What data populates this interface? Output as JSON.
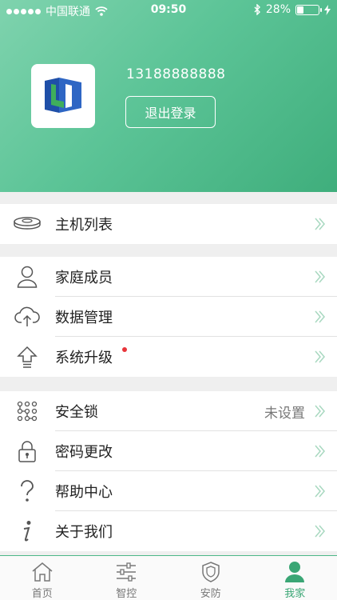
{
  "status_bar": {
    "carrier": "中国联通",
    "time": "09:50",
    "battery_percent": "28%"
  },
  "profile": {
    "phone": "13188888888",
    "logout_label": "退出登录"
  },
  "menu_groups": [
    {
      "items": [
        {
          "icon": "host-device-icon",
          "label": "主机列表",
          "value": ""
        }
      ]
    },
    {
      "items": [
        {
          "icon": "person-icon",
          "label": "家庭成员",
          "value": ""
        },
        {
          "icon": "cloud-upload-icon",
          "label": "数据管理",
          "value": ""
        },
        {
          "icon": "upgrade-arrow-icon",
          "label": "系统升级",
          "value": "",
          "badge": "red-dot"
        }
      ]
    },
    {
      "items": [
        {
          "icon": "pattern-lock-icon",
          "label": "安全锁",
          "value": "未设置"
        },
        {
          "icon": "padlock-icon",
          "label": "密码更改",
          "value": ""
        },
        {
          "icon": "question-icon",
          "label": "帮助中心",
          "value": ""
        },
        {
          "icon": "info-icon",
          "label": "关于我们",
          "value": ""
        }
      ]
    }
  ],
  "tab_bar": {
    "tabs": [
      {
        "icon": "home-icon",
        "label": "首页",
        "active": false
      },
      {
        "icon": "sliders-icon",
        "label": "智控",
        "active": false
      },
      {
        "icon": "shield-icon",
        "label": "安防",
        "active": false
      },
      {
        "icon": "user-icon",
        "label": "我家",
        "active": true
      }
    ]
  },
  "colors": {
    "accent": "#4cb788",
    "header_gradient_start": "#7fd3ae",
    "header_gradient_end": "#3fae7c",
    "badge_red": "#e8343a"
  }
}
